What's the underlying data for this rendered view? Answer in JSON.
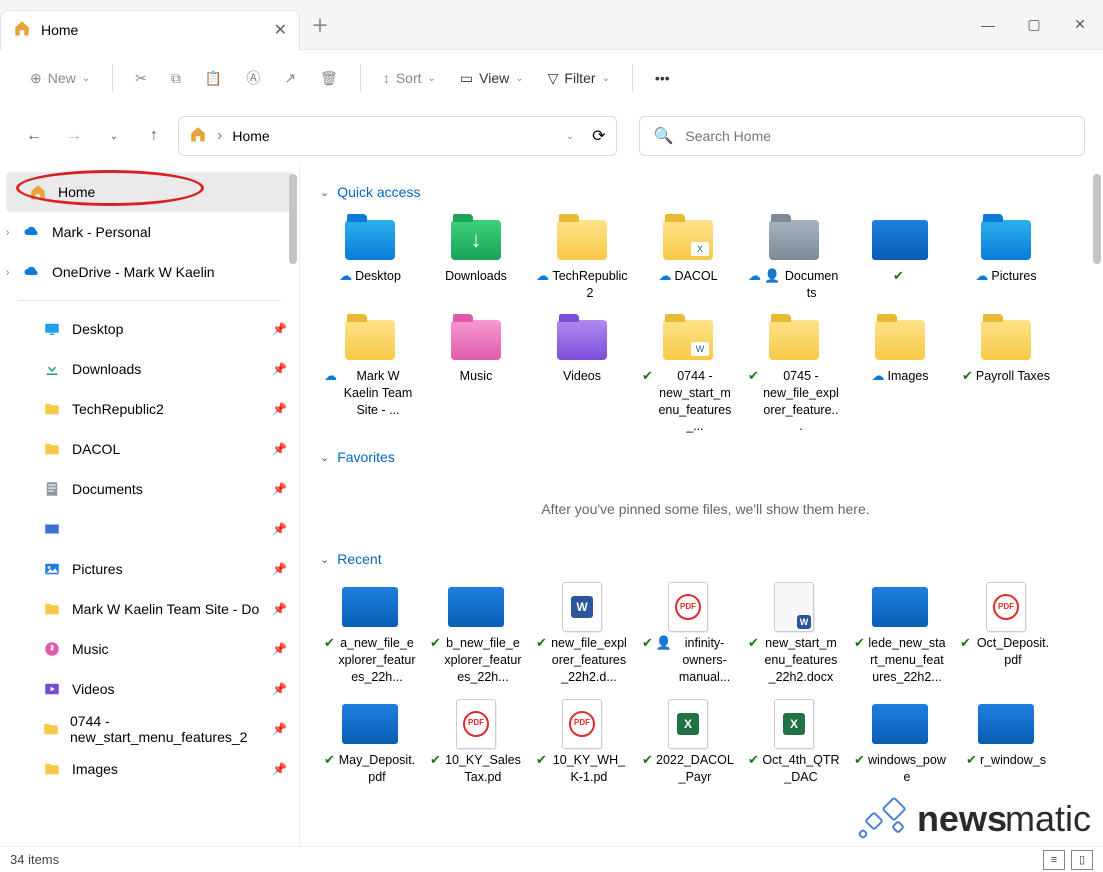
{
  "tab": {
    "title": "Home"
  },
  "toolbar": {
    "new": "New",
    "sort": "Sort",
    "view": "View",
    "filter": "Filter"
  },
  "breadcrumb": {
    "path": "Home"
  },
  "search": {
    "placeholder": "Search Home"
  },
  "sidebar": {
    "top": [
      {
        "label": "Home",
        "icon": "home",
        "active": true
      },
      {
        "label": "Mark - Personal",
        "icon": "onedrive",
        "expandable": true
      },
      {
        "label": "OneDrive - Mark W Kaelin",
        "icon": "onedrive",
        "expandable": true
      }
    ],
    "pinned": [
      {
        "label": "Desktop",
        "icon": "desktop"
      },
      {
        "label": "Downloads",
        "icon": "download"
      },
      {
        "label": "TechRepublic2",
        "icon": "folder"
      },
      {
        "label": "DACOL",
        "icon": "folder"
      },
      {
        "label": "Documents",
        "icon": "docs"
      },
      {
        "label": "",
        "icon": "app"
      },
      {
        "label": "Pictures",
        "icon": "pictures"
      },
      {
        "label": "Mark W Kaelin Team Site - Do",
        "icon": "folder"
      },
      {
        "label": "Music",
        "icon": "music"
      },
      {
        "label": "Videos",
        "icon": "videos"
      },
      {
        "label": "0744 - new_start_menu_features_2",
        "icon": "folder"
      },
      {
        "label": "Images",
        "icon": "folder"
      }
    ]
  },
  "sections": {
    "quick": "Quick access",
    "favorites": "Favorites",
    "favorites_msg": "After you've pinned some files, we'll show them here.",
    "recent": "Recent"
  },
  "quick": [
    {
      "name": "Desktop",
      "status": "cloud",
      "type": "fld-blue"
    },
    {
      "name": "Downloads",
      "status": "",
      "type": "fld-green",
      "glyph": "↓"
    },
    {
      "name": "TechRepublic2",
      "status": "cloud",
      "type": "fld-yellow"
    },
    {
      "name": "DACOL",
      "status": "cloud",
      "type": "fld-yellow",
      "badge": "x"
    },
    {
      "name": "Documents",
      "status": "cloud-person",
      "type": "fld-gray"
    },
    {
      "name": "",
      "status": "sync",
      "type": "img-blue"
    },
    {
      "name": "Pictures",
      "status": "cloud",
      "type": "fld-blue"
    },
    {
      "name": "Mark W Kaelin Team Site - ...",
      "status": "cloud",
      "type": "fld-yellow"
    },
    {
      "name": "Music",
      "status": "",
      "type": "fld-pink"
    },
    {
      "name": "Videos",
      "status": "",
      "type": "fld-purple"
    },
    {
      "name": "0744 - new_start_menu_features_...",
      "status": "sync",
      "type": "fld-yellow",
      "badge": "w"
    },
    {
      "name": "0745 - new_file_explorer_feature...",
      "status": "sync",
      "type": "fld-yellow"
    },
    {
      "name": "Images",
      "status": "cloud",
      "type": "fld-yellow"
    },
    {
      "name": "Payroll Taxes",
      "status": "sync",
      "type": "fld-yellow"
    }
  ],
  "recent": [
    {
      "name": "a_new_file_explorer_features_22h...",
      "status": "sync",
      "type": "img"
    },
    {
      "name": "b_new_file_explorer_features_22h...",
      "status": "sync",
      "type": "img"
    },
    {
      "name": "new_file_explorer_features_22h2.d...",
      "status": "sync",
      "type": "word"
    },
    {
      "name": "infinity-owners-manual...",
      "status": "sync-person",
      "type": "pdf"
    },
    {
      "name": "new_start_menu_features_22h2.docx",
      "status": "sync",
      "type": "word-sm"
    },
    {
      "name": "lede_new_start_menu_features_22h2...",
      "status": "sync",
      "type": "img-blue"
    },
    {
      "name": "Oct_Deposit.pdf",
      "status": "sync",
      "type": "pdf"
    },
    {
      "name": "May_Deposit.pdf",
      "status": "sync",
      "type": "img"
    },
    {
      "name": "10_KY_SalesTax.pd",
      "status": "sync",
      "type": "pdf"
    },
    {
      "name": "10_KY_WH_K-1.pd",
      "status": "sync",
      "type": "pdf"
    },
    {
      "name": "2022_DACOL_Payr",
      "status": "sync",
      "type": "excel"
    },
    {
      "name": "Oct_4th_QTR_DAC",
      "status": "sync",
      "type": "excel"
    },
    {
      "name": "windows_powe",
      "status": "sync",
      "type": "img"
    },
    {
      "name": "r_window_s",
      "status": "sync",
      "type": "img"
    }
  ],
  "status": {
    "count": "34 items"
  },
  "watermark": "newsmatic"
}
